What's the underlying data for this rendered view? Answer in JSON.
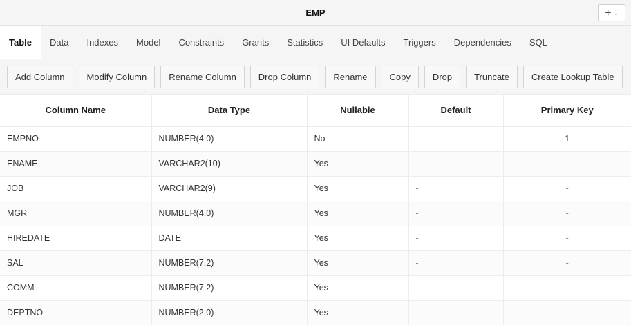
{
  "window": {
    "title": "EMP",
    "add_menu_icon": "plus-icon",
    "add_menu_chevron": "chevron-down-icon"
  },
  "tabs": [
    {
      "label": "Table",
      "active": true
    },
    {
      "label": "Data"
    },
    {
      "label": "Indexes"
    },
    {
      "label": "Model"
    },
    {
      "label": "Constraints"
    },
    {
      "label": "Grants"
    },
    {
      "label": "Statistics"
    },
    {
      "label": "UI Defaults"
    },
    {
      "label": "Triggers"
    },
    {
      "label": "Dependencies"
    },
    {
      "label": "SQL"
    }
  ],
  "toolbar": {
    "add_column": "Add Column",
    "modify_column": "Modify Column",
    "rename_column": "Rename Column",
    "drop_column": "Drop Column",
    "rename": "Rename",
    "copy": "Copy",
    "drop": "Drop",
    "truncate": "Truncate",
    "create_lookup_table": "Create Lookup Table"
  },
  "table": {
    "headers": [
      "Column Name",
      "Data Type",
      "Nullable",
      "Default",
      "Primary Key"
    ],
    "rows": [
      [
        "EMPNO",
        "NUMBER(4,0)",
        "No",
        "-",
        "1"
      ],
      [
        "ENAME",
        "VARCHAR2(10)",
        "Yes",
        "-",
        "-"
      ],
      [
        "JOB",
        "VARCHAR2(9)",
        "Yes",
        "-",
        "-"
      ],
      [
        "MGR",
        "NUMBER(4,0)",
        "Yes",
        "-",
        "-"
      ],
      [
        "HIREDATE",
        "DATE",
        "Yes",
        "-",
        "-"
      ],
      [
        "SAL",
        "NUMBER(7,2)",
        "Yes",
        "-",
        "-"
      ],
      [
        "COMM",
        "NUMBER(7,2)",
        "Yes",
        "-",
        "-"
      ],
      [
        "DEPTNO",
        "NUMBER(2,0)",
        "Yes",
        "-",
        "-"
      ]
    ]
  }
}
